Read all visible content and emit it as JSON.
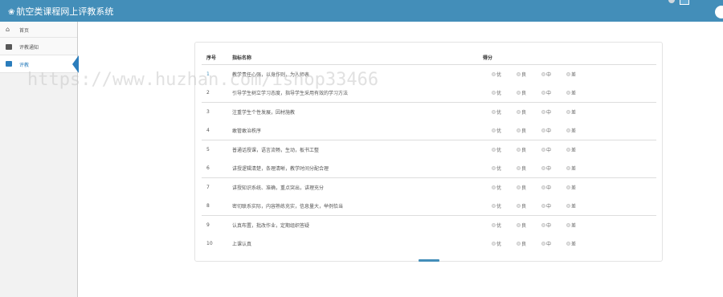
{
  "app": {
    "title": "航空类课程网上评教系统"
  },
  "sidebar": {
    "items": [
      {
        "label": "首页",
        "icon": "home-icon"
      },
      {
        "label": "评教通知",
        "icon": "folder-icon"
      },
      {
        "label": "评教",
        "icon": "folder-icon"
      }
    ]
  },
  "table": {
    "headers": {
      "no": "序号",
      "name": "指标名称",
      "score": "得分"
    },
    "options": [
      "优",
      "良",
      "中",
      "差"
    ],
    "rows": [
      {
        "no": "1",
        "name": "教学责任心强，以身作则，为人师表"
      },
      {
        "no": "2",
        "name": "引导学生树立学习态度，指导学生采用有效的学习方法"
      },
      {
        "no": "3",
        "name": "注重学生个性发展，因材施教"
      },
      {
        "no": "4",
        "name": "敢管敢治秩序"
      },
      {
        "no": "5",
        "name": "普通话授课，语言流畅，生动，板书工整"
      },
      {
        "no": "6",
        "name": "讲授逻辑清楚，条理清晰，教学时间分配合理"
      },
      {
        "no": "7",
        "name": "讲授知识系统、准确，重点突出，讲理充分"
      },
      {
        "no": "8",
        "name": "密切联系实际，内容熟练充实，信息量大，举例恰当"
      },
      {
        "no": "9",
        "name": "认真布置，批改作业，定期组织答疑"
      },
      {
        "no": "10",
        "name": "上课认真"
      }
    ]
  },
  "watermark": "https://www.huzhan.com/ishop33466",
  "colors": {
    "topbar": "#438eb9",
    "active": "#2b7dbc"
  }
}
